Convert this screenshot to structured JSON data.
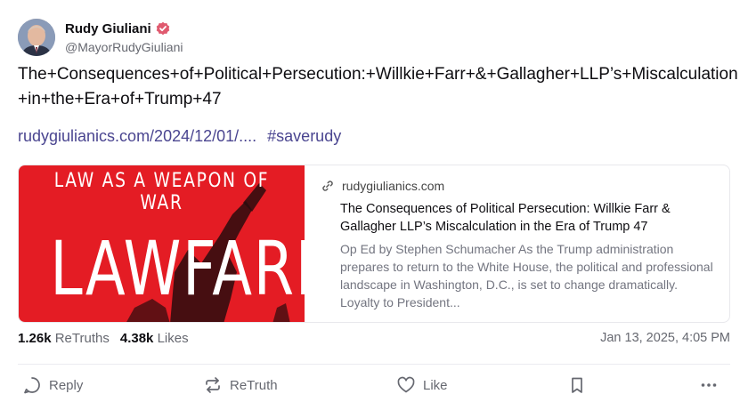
{
  "author": {
    "display_name": "Rudy Giuliani",
    "handle": "@MayorRudyGiuliani",
    "avatar_icon": "avatar-portrait",
    "verified_icon": "verified-badge-icon",
    "verified_color": "#e05a6f"
  },
  "post": {
    "text": "The+Consequences+of+Political+Persecution:+Willkie+Farr+&+Gallagher+LLP’s+Miscalculation+in+the+Era+of+Trump+47",
    "link_text": "rudygiulianics.com/2024/12/01/....",
    "hashtag": "#saverudy",
    "link_color": "#4a4590"
  },
  "card": {
    "image_subtitle": "LAW AS A WEAPON OF WAR",
    "image_title": "LAWFARE",
    "image_bg": "#e41c24",
    "domain": "rudygiulianics.com",
    "title": "The Consequences of Political Persecution: Willkie Farr & Gallagher LLP’s Miscalculation in the Era of Trump 47",
    "description": "Op Ed by Stephen Schumacher As the Trump administration prepares to return to the White House, the political and professional landscape in Washington, D.C., is set to change dramatically. Loyalty to President..."
  },
  "stats": {
    "retruths_count": "1.26k",
    "retruths_label": "ReTruths",
    "likes_count": "4.38k",
    "likes_label": "Likes",
    "timestamp": "Jan 13, 2025, 4:05 PM"
  },
  "actions": {
    "reply_label": "Reply",
    "retruth_label": "ReTruth",
    "like_label": "Like",
    "bookmark_icon": "bookmark-icon",
    "more_icon": "more-icon"
  }
}
